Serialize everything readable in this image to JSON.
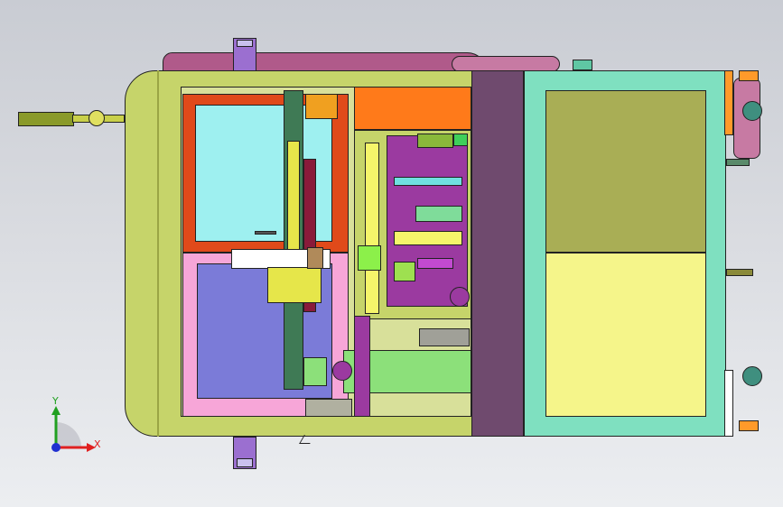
{
  "viewport": {
    "background_top": "#c9ccd3",
    "background_bottom": "#eceef1"
  },
  "triad": {
    "x_label": "X",
    "y_label": "Y",
    "x_color": "#e02020",
    "y_color": "#20a020",
    "z_color": "#2030d0"
  },
  "colors": {
    "frame": "#c6d46a",
    "frame_dark": "#b8c55a",
    "cabinet_panel": "#7fe0c0",
    "olive_panel": "#a9ae55",
    "yellow_panel": "#f5f58a",
    "divider": "#6f4a6e",
    "orange": "#ff7a1a",
    "red_frame": "#e04a1a",
    "cyan_window": "#9ef0f0",
    "pink": "#f7a6d8",
    "lavender": "#7b7bd8",
    "dark_green": "#3f7a55",
    "maroon": "#8a1a3a",
    "magenta": "#9b3aa0",
    "rose": "#b05a8a"
  }
}
